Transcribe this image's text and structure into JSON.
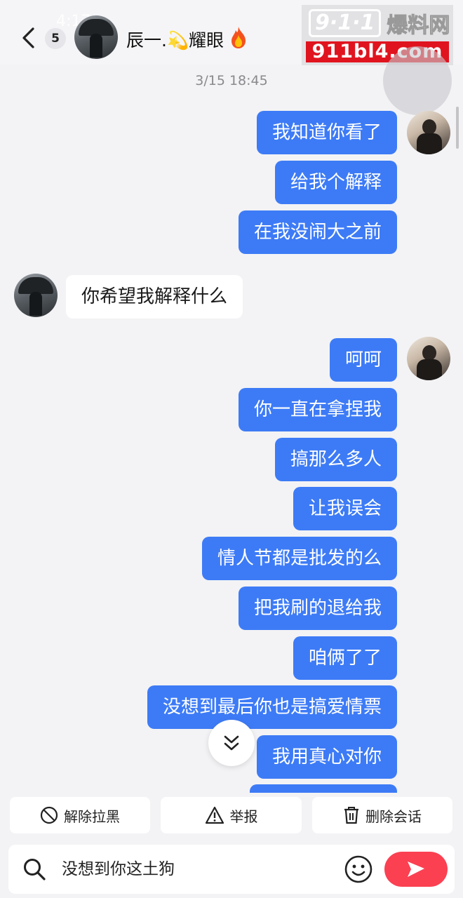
{
  "status_bar": {
    "time": "4:17"
  },
  "header": {
    "unread_count": "5",
    "contact_name": "辰一.💫耀眼",
    "fire_icon": "fire-icon",
    "back_icon": "chevron-left-icon"
  },
  "watermark": {
    "number_text": "9·1·1",
    "cn_text": "爆料网",
    "url": "911bl4.com"
  },
  "chat": {
    "timestamp": "3/15 18:45",
    "messages": [
      {
        "side": "out",
        "text": "我知道你看了",
        "avatar": true
      },
      {
        "side": "out",
        "text": "给我个解释",
        "avatar": false
      },
      {
        "side": "out",
        "text": "在我没闹大之前",
        "avatar": false
      },
      {
        "side": "in",
        "text": "你希望我解释什么",
        "avatar": true
      },
      {
        "side": "out",
        "text": "呵呵",
        "avatar": true
      },
      {
        "side": "out",
        "text": "你一直在拿捏我",
        "avatar": false
      },
      {
        "side": "out",
        "text": "搞那么多人",
        "avatar": false
      },
      {
        "side": "out",
        "text": "让我误会",
        "avatar": false
      },
      {
        "side": "out",
        "text": "情人节都是批发的么",
        "avatar": false
      },
      {
        "side": "out",
        "text": "把我刷的退给我",
        "avatar": false
      },
      {
        "side": "out",
        "text": "咱俩了了",
        "avatar": false
      },
      {
        "side": "out",
        "text": "没想到最后你也是搞爱情票",
        "avatar": false
      },
      {
        "side": "out",
        "text": "我用真心对你",
        "avatar": false
      }
    ]
  },
  "actions": {
    "unblock": {
      "label": "解除拉黑",
      "icon": "prohibited-icon"
    },
    "report": {
      "label": "举报",
      "icon": "warning-icon"
    },
    "delete": {
      "label": "删除会话",
      "icon": "trash-icon"
    }
  },
  "composer": {
    "value": "没想到你这土狗",
    "search_icon": "search-icon",
    "emoji_icon": "emoji-icon",
    "send_icon": "send-icon"
  },
  "colors": {
    "outgoing_bubble": "#3d7bf6",
    "incoming_bubble": "#ffffff",
    "send_button": "#fb4052",
    "background": "#f3f3f5"
  }
}
